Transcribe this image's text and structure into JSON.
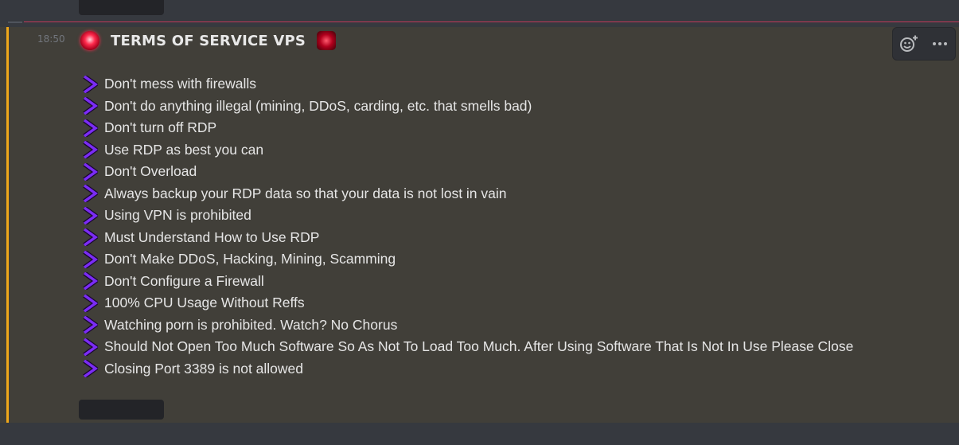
{
  "message": {
    "timestamp": "18:50",
    "title": "TERMS OF SERVICE VPS",
    "emoji_left": "rotating-light-icon",
    "emoji_right": "red-siren-icon",
    "rules": [
      "Don't mess with firewalls",
      "Don't do anything illegal (mining, DDoS, carding, etc. that smells bad)",
      "Don't turn off RDP",
      "Use RDP as best you can",
      "Don't Overload",
      "Always backup your RDP data so that your data is not lost in vain",
      "Using VPN is prohibited",
      "Must Understand How to Use RDP",
      "Don't Make DDoS, Hacking, Mining, Scamming",
      "Don't Configure a Firewall",
      "100% CPU Usage Without Reffs",
      "Watching porn is prohibited. Watch? No Chorus",
      "Should Not Open Too Much Software So As Not To Load Too Much. After Using Software That Is Not In Use Please Close",
      "Closing Port 3389 is not allowed"
    ]
  },
  "toolbar": {
    "icons": [
      "add-reaction-icon",
      "more-options-icon"
    ]
  },
  "colors": {
    "background": "#36393f",
    "message_highlight": "#413f39",
    "accent_bar": "#f0a81a",
    "new_divider": "#c0395a",
    "chevron": "#7b2cf5",
    "text": "#e6e6e6"
  }
}
